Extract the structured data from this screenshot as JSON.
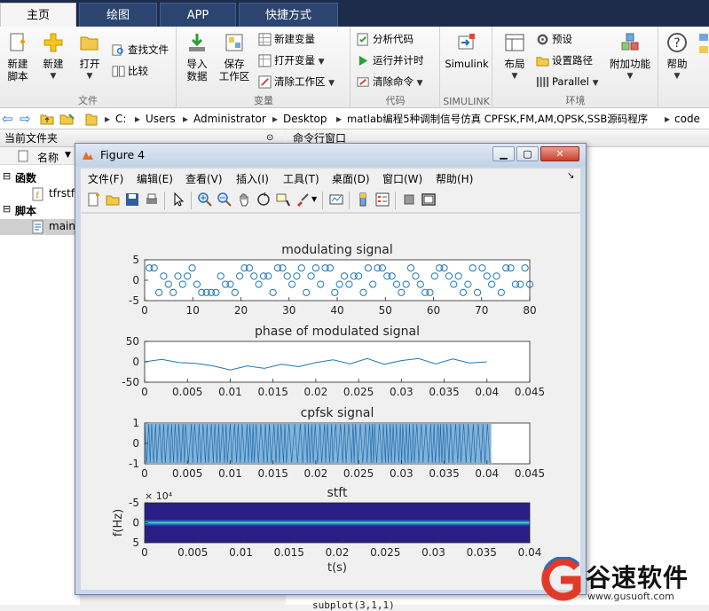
{
  "tabs": [
    "主页",
    "绘图",
    "APP",
    "快捷方式"
  ],
  "ribbon": {
    "file_group_label": "文件",
    "var_group_label": "变量",
    "code_group_label": "代码",
    "simulink_group_label": "SIMULINK",
    "env_group_label": "环境",
    "new_script": "新建\n脚本",
    "new": "新建",
    "open": "打开",
    "find_files": "查找文件",
    "compare": "比较",
    "import_data": "导入\n数据",
    "save_workspace": "保存\n工作区",
    "new_variable": "新建变量",
    "open_variable": "打开变量",
    "clear_workspace": "清除工作区",
    "analyze_code": "分析代码",
    "run_and_time": "运行并计时",
    "clear_commands": "清除命令",
    "simulink": "Simulink",
    "layout": "布局",
    "preferences": "预设",
    "set_path": "设置路径",
    "parallel": "Parallel",
    "addons": "附加功能",
    "help": "帮助"
  },
  "address": {
    "parts": [
      "C:",
      "Users",
      "Administrator",
      "Desktop",
      "matlab编程5种调制信号仿真 CPFSK,FM,AM,QPSK,SSB源码程序",
      "code"
    ]
  },
  "current_folder": {
    "title": "当前文件夹",
    "col_name": "名称",
    "group_functions": "函数",
    "file_function": "tfrstft",
    "group_scripts": "脚本",
    "file_script": "main"
  },
  "command_window": {
    "title": "命令行窗口",
    "line_subplot": "subplot(3,1,1)"
  },
  "figure": {
    "title": "Figure 4",
    "menu": [
      "文件(F)",
      "编辑(E)",
      "查看(V)",
      "插入(I)",
      "工具(T)",
      "桌面(D)",
      "窗口(W)",
      "帮助(H)"
    ],
    "xlabel_bottom": "t(s)",
    "ylabel_stft": "f(Hz)",
    "exponent": "× 10⁴"
  },
  "chart_data": [
    {
      "type": "scatter",
      "title": "modulating signal",
      "xlim": [
        0,
        80
      ],
      "ylim": [
        -5,
        5
      ],
      "xticks": [
        0,
        10,
        20,
        30,
        40,
        50,
        60,
        70,
        80
      ],
      "yticks": [
        5,
        0,
        -5
      ],
      "color": "#1f77b4",
      "values": [
        3,
        3,
        -3,
        1,
        -1,
        -3,
        1,
        -1,
        1,
        3,
        -1,
        -3,
        -3,
        -3,
        -3,
        1,
        -1,
        -1,
        -3,
        1,
        3,
        3,
        1,
        -1,
        1,
        1,
        -3,
        3,
        3,
        1,
        -1,
        1,
        3,
        -3,
        1,
        3,
        -1,
        3,
        3,
        -3,
        -1,
        1,
        -1,
        1,
        1,
        -3,
        3,
        -1,
        3,
        3,
        1,
        1,
        -1,
        -3,
        -1,
        3,
        1,
        -1,
        -3,
        -3,
        1,
        3,
        3,
        1,
        -1,
        1,
        -3,
        -1,
        3,
        -3,
        3,
        1,
        -1,
        1,
        -3,
        3,
        3,
        -1,
        -1,
        3,
        -1
      ]
    },
    {
      "type": "line",
      "title": "phase of modulated signal",
      "xlim": [
        0,
        0.045
      ],
      "ylim": [
        -50,
        50
      ],
      "xticks": [
        "0",
        "0.005",
        "0.01",
        "0.015",
        "0.02",
        "0.025",
        "0.03",
        "0.035",
        "0.04",
        "0.045"
      ],
      "yticks": [
        50,
        0,
        -50
      ],
      "color": "#1f77b4",
      "x": [
        0,
        0.002,
        0.004,
        0.006,
        0.008,
        0.009,
        0.01,
        0.012,
        0.014,
        0.016,
        0.018,
        0.02,
        0.022,
        0.024,
        0.026,
        0.028,
        0.03,
        0.032,
        0.034,
        0.036,
        0.038,
        0.04
      ],
      "y": [
        0,
        6,
        -2,
        -4,
        -10,
        -15,
        -20,
        -10,
        -16,
        -6,
        -12,
        -2,
        5,
        -5,
        8,
        -6,
        3,
        8,
        -5,
        7,
        -3,
        0
      ]
    },
    {
      "type": "area",
      "title": "cpfsk signal",
      "xlim": [
        0,
        0.045
      ],
      "ylim": [
        -1,
        1
      ],
      "xticks": [
        "0",
        "0.005",
        "0.01",
        "0.015",
        "0.02",
        "0.025",
        "0.03",
        "0.035",
        "0.04",
        "0.045"
      ],
      "yticks": [
        1,
        0,
        -1
      ],
      "color": "#1f77b4",
      "signal_end": 0.0405
    },
    {
      "type": "heatmap",
      "title": "stft",
      "xlim": [
        0,
        0.04
      ],
      "ylim": [
        -5,
        5
      ],
      "xticks": [
        "0",
        "0.005",
        "0.01",
        "0.015",
        "0.02",
        "0.025",
        "0.03",
        "0.035",
        "0.04"
      ],
      "yticks": [
        "-5",
        "0",
        "5"
      ],
      "background": "#2a1e86"
    }
  ],
  "watermark": {
    "brand": "谷速软件",
    "url": "www.gusuoft.com"
  }
}
